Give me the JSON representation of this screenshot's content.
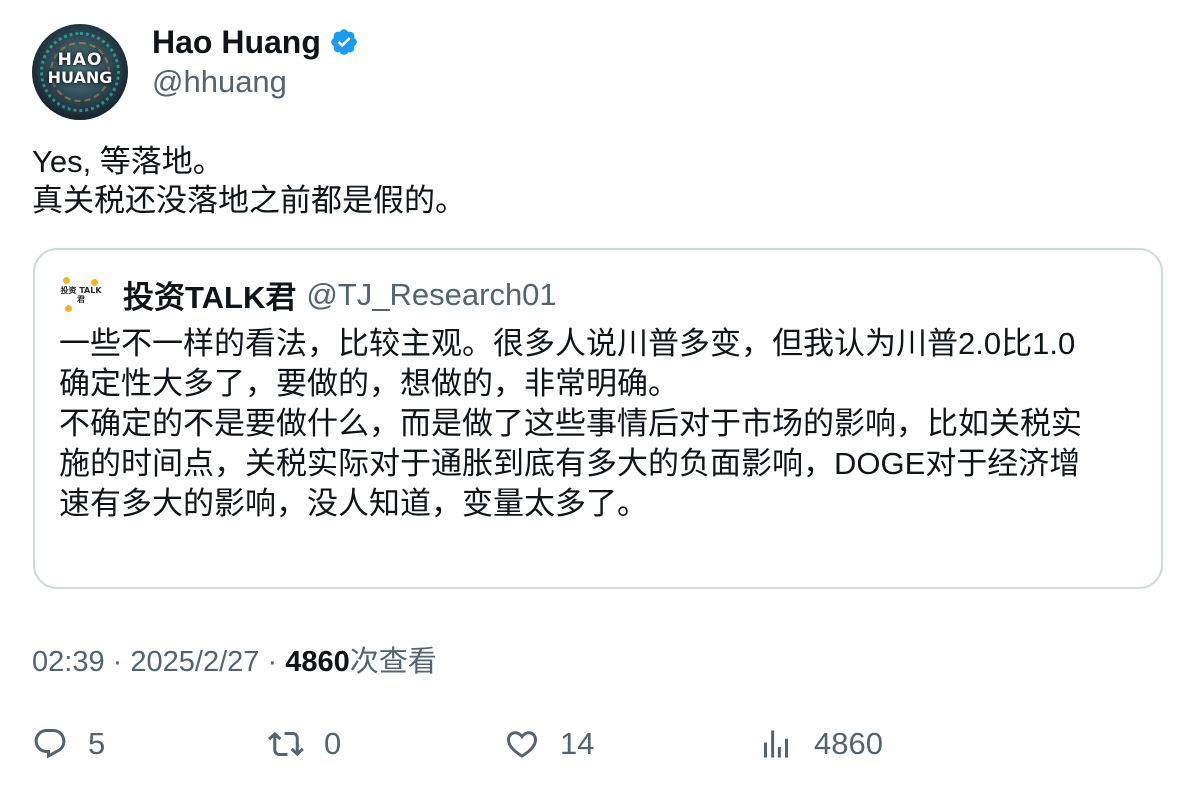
{
  "author": {
    "display_name": "Hao Huang",
    "handle": "@hhuang",
    "avatar_text_line1": "HAO",
    "avatar_text_line2": "HUANG",
    "verified_color": "#1d9bf0"
  },
  "tweet": {
    "lines": [
      "Yes, 等落地。",
      "真关税还没落地之前都是假的。"
    ]
  },
  "quoted": {
    "avatar_text": "投资 TALK君",
    "display_name": "投资TALK君",
    "handle": "@TJ_Research01",
    "lines": [
      "一些不一样的看法，比较主观。很多人说川普多变，但我认为川普2.0比1.0",
      "确定性大多了，要做的，想做的，非常明确。",
      "不确定的不是要做什么，而是做了这些事情后对于市场的影响，比如关税实",
      "施的时间点，关税实际对于通胀到底有多大的负面影响，DOGE对于经济增",
      "速有多大的影响，没人知道，变量太多了。"
    ]
  },
  "meta": {
    "time": "02:39",
    "sep": "·",
    "date": "2025/2/27",
    "views_count": "4860",
    "views_label": "次查看"
  },
  "actions": {
    "reply_count": "5",
    "retweet_count": "0",
    "like_count": "14",
    "views_count": "4860",
    "icon_color": "#536471"
  }
}
